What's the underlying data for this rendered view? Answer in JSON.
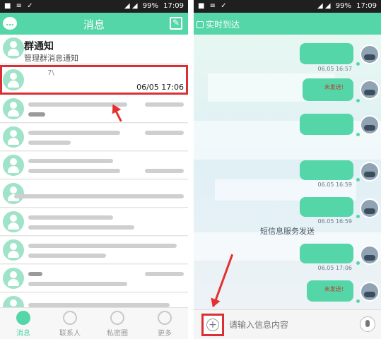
{
  "status_bar": {
    "left_icons": "■ ≡ ✓",
    "signal_icons": "◢ ◢",
    "battery": "99%",
    "time": "17:09"
  },
  "left_screen": {
    "title": "消息",
    "group_notice": {
      "name": "群通知",
      "subtitle": "管理群消息通知"
    },
    "highlighted_item": {
      "snippet": "7\\",
      "time": "06/05 17:06"
    },
    "tabs": [
      {
        "label": "消息",
        "active": true
      },
      {
        "label": "联系人",
        "active": false
      },
      {
        "label": "私密圈",
        "active": false
      },
      {
        "label": "更多",
        "active": false
      }
    ]
  },
  "right_screen": {
    "realtime_label": "实时到达",
    "messages": [
      {
        "time": "06.05 16:57",
        "failed": false
      },
      {
        "time": "",
        "failed": true
      },
      {
        "time": "",
        "failed": false
      },
      {
        "time": "06.05 16:59",
        "failed": false
      },
      {
        "time": "06.05 16:59",
        "failed": false
      },
      {
        "time": "06.05 17:06",
        "failed": false
      },
      {
        "time": "",
        "failed": true
      }
    ],
    "failed_label": "未发送!",
    "sms_notice": "短信息服务发送",
    "input": {
      "placeholder": "请输入信息内容",
      "value": ""
    }
  },
  "colors": {
    "accent": "#55d6a8",
    "highlight_red": "#d93036",
    "status_bar": "#1f1f1f"
  },
  "icons": {
    "chat": "chat-bubble-icon",
    "compose": "compose-icon",
    "add": "plus-icon",
    "voice": "microphone-icon"
  }
}
